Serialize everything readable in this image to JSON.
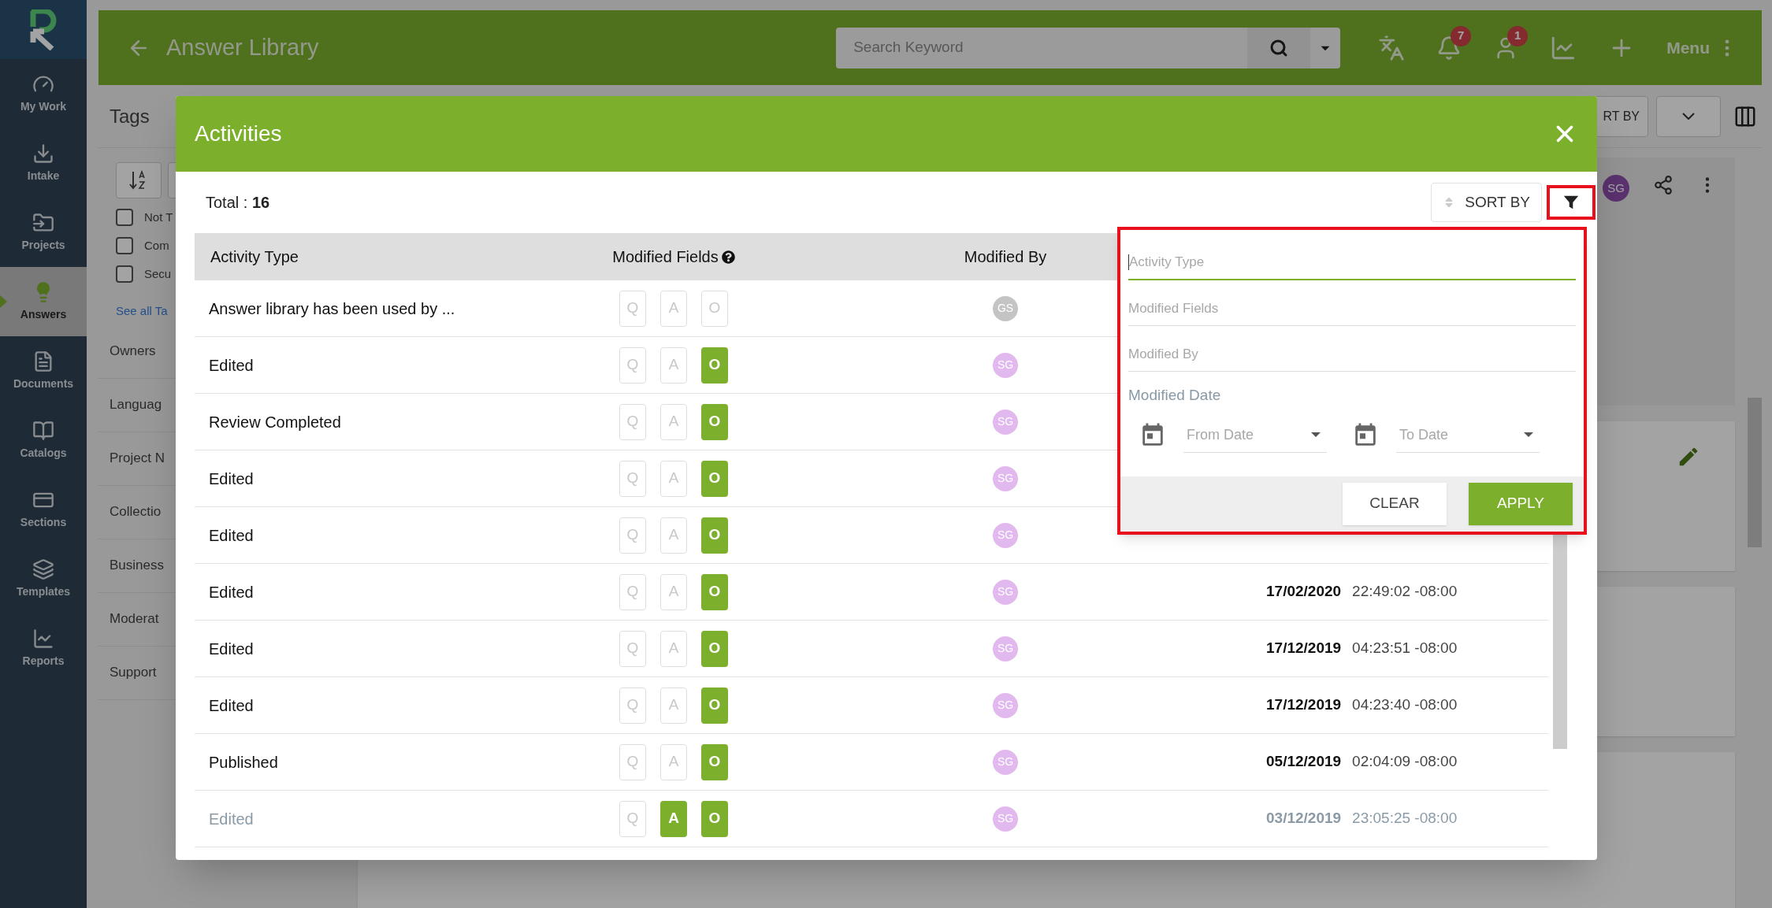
{
  "sidebar": {
    "items": [
      {
        "label": "My Work",
        "selected": false
      },
      {
        "label": "Intake",
        "selected": false
      },
      {
        "label": "Projects",
        "selected": false
      },
      {
        "label": "Answers",
        "selected": true
      },
      {
        "label": "Documents",
        "selected": false
      },
      {
        "label": "Catalogs",
        "selected": false
      },
      {
        "label": "Sections",
        "selected": false
      },
      {
        "label": "Templates",
        "selected": false
      },
      {
        "label": "Reports",
        "selected": false
      }
    ]
  },
  "header": {
    "title": "Answer Library",
    "search_placeholder": "Search Keyword",
    "notification_count": "7",
    "user_count": "1",
    "menu_label": "Menu"
  },
  "left_panel": {
    "title": "Tags",
    "tags": [
      {
        "label": "Not T",
        "checked": false
      },
      {
        "label": "Com",
        "checked": false
      },
      {
        "label": "Secu",
        "checked": false
      }
    ],
    "see_all": "See all Ta",
    "sections": [
      "Owners",
      "Languag",
      "Project N",
      "Collectio",
      "Business",
      "Moderat",
      "Support"
    ]
  },
  "toolbar": {
    "sort_label": "RT BY"
  },
  "card": {
    "avatar": "SG"
  },
  "modal": {
    "title": "Activities",
    "total_label": "Total :",
    "total_value": "16",
    "sort_label": "SORT BY",
    "columns": [
      "Activity Type",
      "Modified Fields",
      "Modified By"
    ],
    "rows": [
      {
        "activity": "Answer library has been used by ...",
        "fields": [
          {
            "letter": "Q",
            "on": false
          },
          {
            "letter": "A",
            "on": false
          },
          {
            "letter": "O",
            "on": false
          }
        ],
        "user": "GS",
        "color": "#c4c4c4",
        "disabled": false
      },
      {
        "activity": "Edited",
        "fields": [
          {
            "letter": "Q",
            "on": false
          },
          {
            "letter": "A",
            "on": false
          },
          {
            "letter": "O",
            "on": true
          }
        ],
        "user": "SG",
        "color": "#e2b9ef",
        "disabled": false
      },
      {
        "activity": "Review Completed",
        "fields": [
          {
            "letter": "Q",
            "on": false
          },
          {
            "letter": "A",
            "on": false
          },
          {
            "letter": "O",
            "on": true
          }
        ],
        "user": "SG",
        "color": "#e2b9ef",
        "disabled": false
      },
      {
        "activity": "Edited",
        "fields": [
          {
            "letter": "Q",
            "on": false
          },
          {
            "letter": "A",
            "on": false
          },
          {
            "letter": "O",
            "on": true
          }
        ],
        "user": "SG",
        "color": "#e2b9ef",
        "disabled": false
      },
      {
        "activity": "Edited",
        "fields": [
          {
            "letter": "Q",
            "on": false
          },
          {
            "letter": "A",
            "on": false
          },
          {
            "letter": "O",
            "on": true
          }
        ],
        "user": "SG",
        "color": "#e2b9ef",
        "disabled": false
      },
      {
        "activity": "Edited",
        "fields": [
          {
            "letter": "Q",
            "on": false
          },
          {
            "letter": "A",
            "on": false
          },
          {
            "letter": "O",
            "on": true
          }
        ],
        "user": "SG",
        "color": "#e2b9ef",
        "date": "17/02/2020",
        "time": "22:49:02 -08:00",
        "disabled": false
      },
      {
        "activity": "Edited",
        "fields": [
          {
            "letter": "Q",
            "on": false
          },
          {
            "letter": "A",
            "on": false
          },
          {
            "letter": "O",
            "on": true
          }
        ],
        "user": "SG",
        "color": "#e2b9ef",
        "date": "17/12/2019",
        "time": "04:23:51 -08:00",
        "disabled": false
      },
      {
        "activity": "Edited",
        "fields": [
          {
            "letter": "Q",
            "on": false
          },
          {
            "letter": "A",
            "on": false
          },
          {
            "letter": "O",
            "on": true
          }
        ],
        "user": "SG",
        "color": "#e2b9ef",
        "date": "17/12/2019",
        "time": "04:23:40 -08:00",
        "disabled": false
      },
      {
        "activity": "Published",
        "fields": [
          {
            "letter": "Q",
            "on": false
          },
          {
            "letter": "A",
            "on": false
          },
          {
            "letter": "O",
            "on": true
          }
        ],
        "user": "SG",
        "color": "#e2b9ef",
        "date": "05/12/2019",
        "time": "02:04:09 -08:00",
        "disabled": false
      },
      {
        "activity": "Edited",
        "fields": [
          {
            "letter": "Q",
            "on": false
          },
          {
            "letter": "A",
            "on": true
          },
          {
            "letter": "O",
            "on": true
          }
        ],
        "user": "SG",
        "color": "#e2b9ef",
        "date": "03/12/2019",
        "time": "23:05:25 -08:00",
        "disabled": true
      }
    ]
  },
  "filter": {
    "fields": [
      {
        "placeholder": "Activity Type",
        "focused": true
      },
      {
        "placeholder": "Modified Fields",
        "focused": false
      },
      {
        "placeholder": "Modified By",
        "focused": false
      }
    ],
    "date_label": "Modified Date",
    "from_placeholder": "From Date",
    "to_placeholder": "To Date",
    "clear_label": "CLEAR",
    "apply_label": "APPLY"
  }
}
